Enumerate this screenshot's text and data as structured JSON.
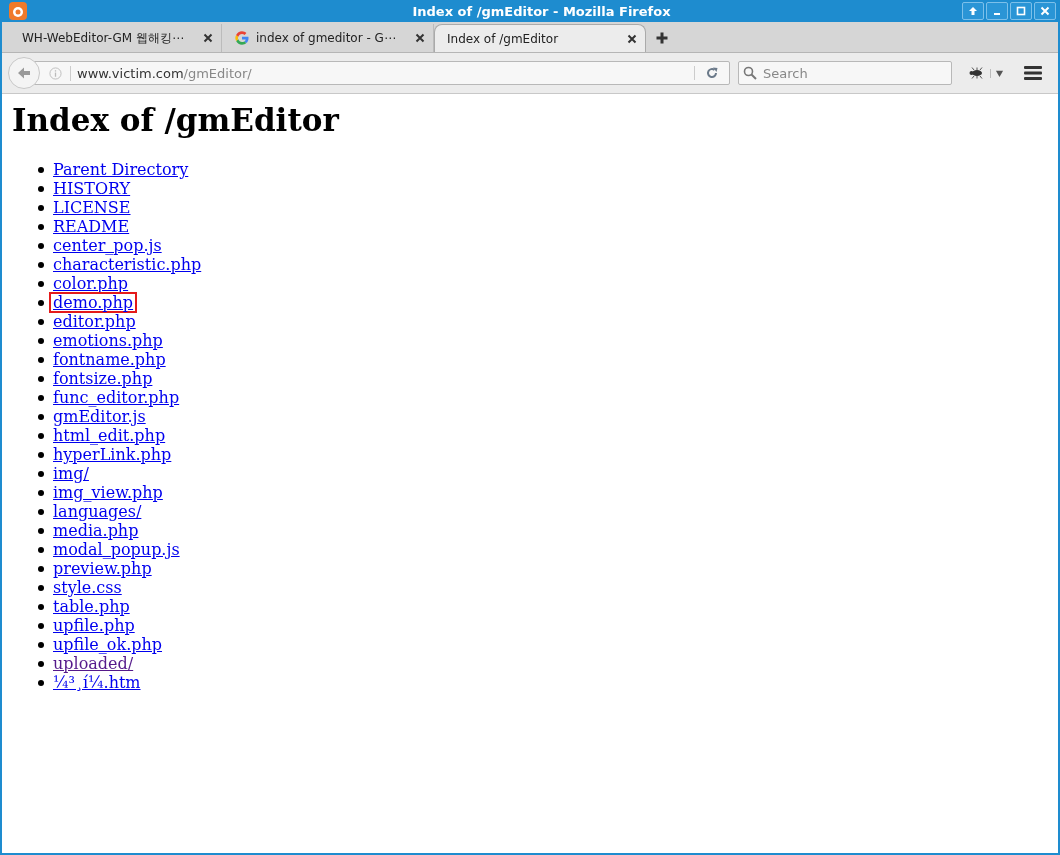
{
  "window": {
    "title": "Index of /gmEditor - Mozilla Firefox"
  },
  "tabs": [
    {
      "label": "WH-WebEditor-GM 웹해킹⋯",
      "selected": false,
      "kind": "plain"
    },
    {
      "label": "index of gmeditor - G⋯",
      "selected": false,
      "kind": "google"
    },
    {
      "label": "Index of /gmEditor",
      "selected": true,
      "kind": "plain"
    }
  ],
  "address": {
    "host": "www.victim.com",
    "path": "/gmEditor/"
  },
  "search": {
    "placeholder": "Search"
  },
  "page": {
    "heading": "Index of /gmEditor",
    "links": [
      {
        "text": "Parent Directory",
        "visited": false,
        "highlighted": false
      },
      {
        "text": "HISTORY",
        "visited": false,
        "highlighted": false
      },
      {
        "text": "LICENSE",
        "visited": false,
        "highlighted": false
      },
      {
        "text": "README",
        "visited": false,
        "highlighted": false
      },
      {
        "text": "center_pop.js",
        "visited": false,
        "highlighted": false
      },
      {
        "text": "characteristic.php",
        "visited": false,
        "highlighted": false
      },
      {
        "text": "color.php",
        "visited": false,
        "highlighted": false
      },
      {
        "text": "demo.php",
        "visited": false,
        "highlighted": true
      },
      {
        "text": "editor.php",
        "visited": false,
        "highlighted": false
      },
      {
        "text": "emotions.php",
        "visited": false,
        "highlighted": false
      },
      {
        "text": "fontname.php",
        "visited": false,
        "highlighted": false
      },
      {
        "text": "fontsize.php",
        "visited": false,
        "highlighted": false
      },
      {
        "text": "func_editor.php",
        "visited": false,
        "highlighted": false
      },
      {
        "text": "gmEditor.js",
        "visited": false,
        "highlighted": false
      },
      {
        "text": "html_edit.php",
        "visited": false,
        "highlighted": false
      },
      {
        "text": "hyperLink.php",
        "visited": false,
        "highlighted": false
      },
      {
        "text": "img/",
        "visited": false,
        "highlighted": false
      },
      {
        "text": "img_view.php",
        "visited": false,
        "highlighted": false
      },
      {
        "text": "languages/",
        "visited": false,
        "highlighted": false
      },
      {
        "text": "media.php",
        "visited": false,
        "highlighted": false
      },
      {
        "text": "modal_popup.js",
        "visited": false,
        "highlighted": false
      },
      {
        "text": "preview.php",
        "visited": false,
        "highlighted": false
      },
      {
        "text": "style.css",
        "visited": false,
        "highlighted": false
      },
      {
        "text": "table.php",
        "visited": false,
        "highlighted": false
      },
      {
        "text": "upfile.php",
        "visited": false,
        "highlighted": false
      },
      {
        "text": "upfile_ok.php",
        "visited": false,
        "highlighted": false
      },
      {
        "text": "uploaded/",
        "visited": true,
        "highlighted": false
      },
      {
        "text": "¼³¸í¼.htm",
        "visited": false,
        "highlighted": false
      }
    ]
  }
}
